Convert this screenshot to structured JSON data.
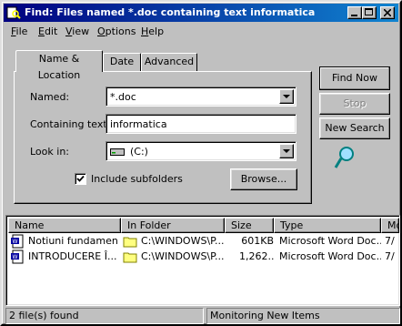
{
  "window": {
    "title": "Find: Files named *.doc containing text informatica"
  },
  "menu": [
    {
      "label": "File",
      "key": "F",
      "rest": "ile"
    },
    {
      "label": "Edit",
      "key": "E",
      "rest": "dit"
    },
    {
      "label": "View",
      "key": "V",
      "rest": "iew"
    },
    {
      "label": "Options",
      "key": "O",
      "rest": "ptions"
    },
    {
      "label": "Help",
      "key": "H",
      "rest": "elp"
    }
  ],
  "tabs": [
    "Name & Location",
    "Date",
    "Advanced"
  ],
  "form": {
    "named_label": "Named:",
    "named_value": "*.doc",
    "containing_label": "Containing text:",
    "containing_value": "informatica",
    "lookin_label": "Look in:",
    "lookin_value": "(C:)",
    "include_subfolders": "Include subfolders",
    "include_subfolders_checked": true,
    "browse": "Browse..."
  },
  "actions": {
    "find_now": "Find Now",
    "stop": "Stop",
    "new_search": "New Search"
  },
  "results": {
    "columns": [
      "Name",
      "In Folder",
      "Size",
      "Type",
      "Mo"
    ],
    "rows": [
      [
        "Notiuni fundament...",
        "C:\\WINDOWS\\P...",
        "601KB",
        "Microsoft Word Doc...",
        "7/"
      ],
      [
        "INTRODUCERE Î...",
        "C:\\WINDOWS\\P...",
        "1,262...",
        "Microsoft Word Doc...",
        "7/"
      ]
    ]
  },
  "status": {
    "count": "2 file(s) found",
    "message": "Monitoring New Items"
  },
  "colors": {
    "title_start": "#000080",
    "title_end": "#1084d0",
    "face": "#c0c0c0"
  }
}
